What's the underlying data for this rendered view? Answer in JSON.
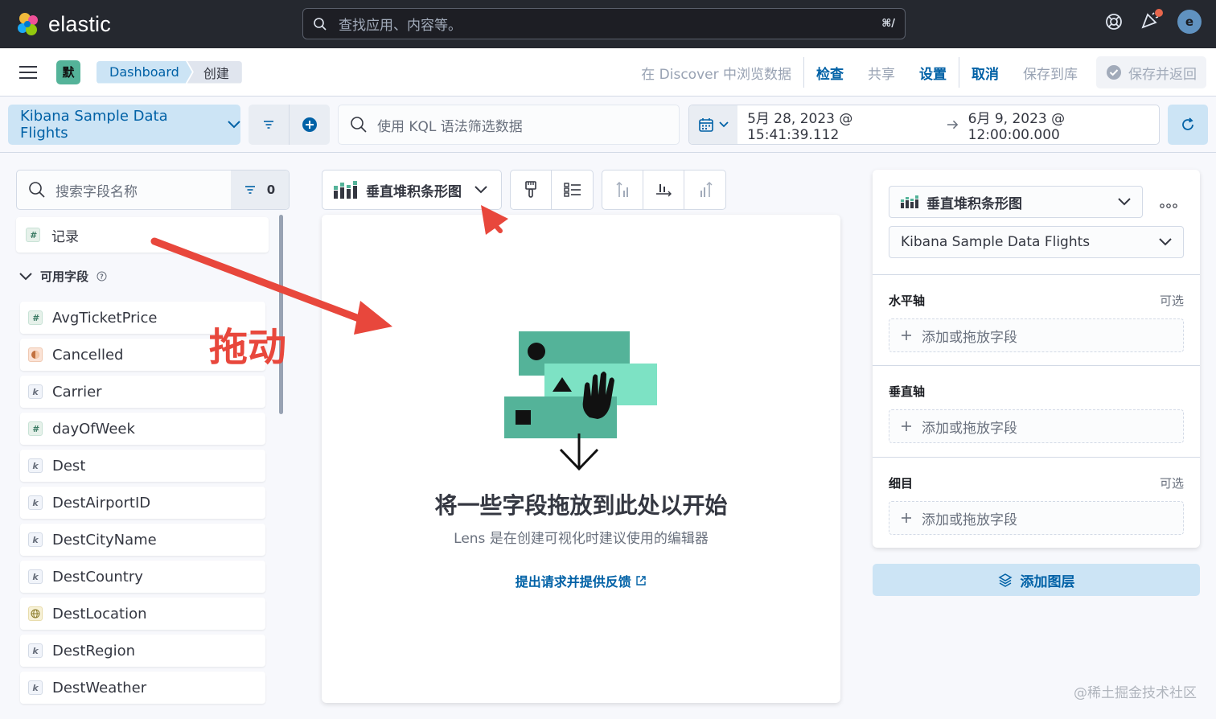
{
  "topbar": {
    "brand": "elastic",
    "search_placeholder": "查找应用、内容等。",
    "search_shortcut": "⌘/",
    "avatar_letter": "e"
  },
  "navbar": {
    "space_badge": "默",
    "breadcrumbs": [
      "Dashboard",
      "创建"
    ],
    "menu": {
      "discover": "在 Discover 中浏览数据",
      "inspect": "检查",
      "share": "共享",
      "settings": "设置",
      "cancel": "取消",
      "save_to_library": "保存到库",
      "save_and_return": "保存并返回"
    }
  },
  "querybar": {
    "data_view": "Kibana Sample Data Flights",
    "kql_placeholder": "使用 KQL 语法筛选数据",
    "date_start": "5月 28, 2023 @ 15:41:39.112",
    "date_end": "6月 9, 2023 @ 12:00:00.000"
  },
  "fields_panel": {
    "search_placeholder": "搜索字段名称",
    "filter_count": "0",
    "records_label": "记录",
    "available_label": "可用字段",
    "fields": [
      {
        "name": "AvgTicketPrice",
        "type": "#",
        "kind": "num"
      },
      {
        "name": "Cancelled",
        "type": "",
        "kind": "bool"
      },
      {
        "name": "Carrier",
        "type": "k",
        "kind": "kw"
      },
      {
        "name": "dayOfWeek",
        "type": "#",
        "kind": "num"
      },
      {
        "name": "Dest",
        "type": "k",
        "kind": "kw"
      },
      {
        "name": "DestAirportID",
        "type": "k",
        "kind": "kw"
      },
      {
        "name": "DestCityName",
        "type": "k",
        "kind": "kw"
      },
      {
        "name": "DestCountry",
        "type": "k",
        "kind": "kw"
      },
      {
        "name": "DestLocation",
        "type": "",
        "kind": "geo"
      },
      {
        "name": "DestRegion",
        "type": "k",
        "kind": "kw"
      },
      {
        "name": "DestWeather",
        "type": "k",
        "kind": "kw"
      }
    ]
  },
  "workspace": {
    "chart_type": "垂直堆积条形图",
    "title": "将一些字段拖放到此处以开始",
    "subtitle": "Lens 是在创建可视化时建议使用的编辑器",
    "feedback_link": "提出请求并提供反馈"
  },
  "config": {
    "chart_type": "垂直堆积条形图",
    "data_view": "Kibana Sample Data Flights",
    "optional_label": "可选",
    "add_field": "添加或拖放字段",
    "dimensions": {
      "x": "水平轴",
      "y": "垂直轴",
      "breakdown": "细目"
    },
    "add_layer": "添加图层"
  },
  "annotation": {
    "text": "拖动",
    "color": "#e8473c"
  },
  "watermark": "@稀土掘金技术社区",
  "colors": {
    "topbar": "#25282f",
    "accent": "#0061a6",
    "accent_bg": "#cce4f5",
    "space": "#54b399"
  }
}
